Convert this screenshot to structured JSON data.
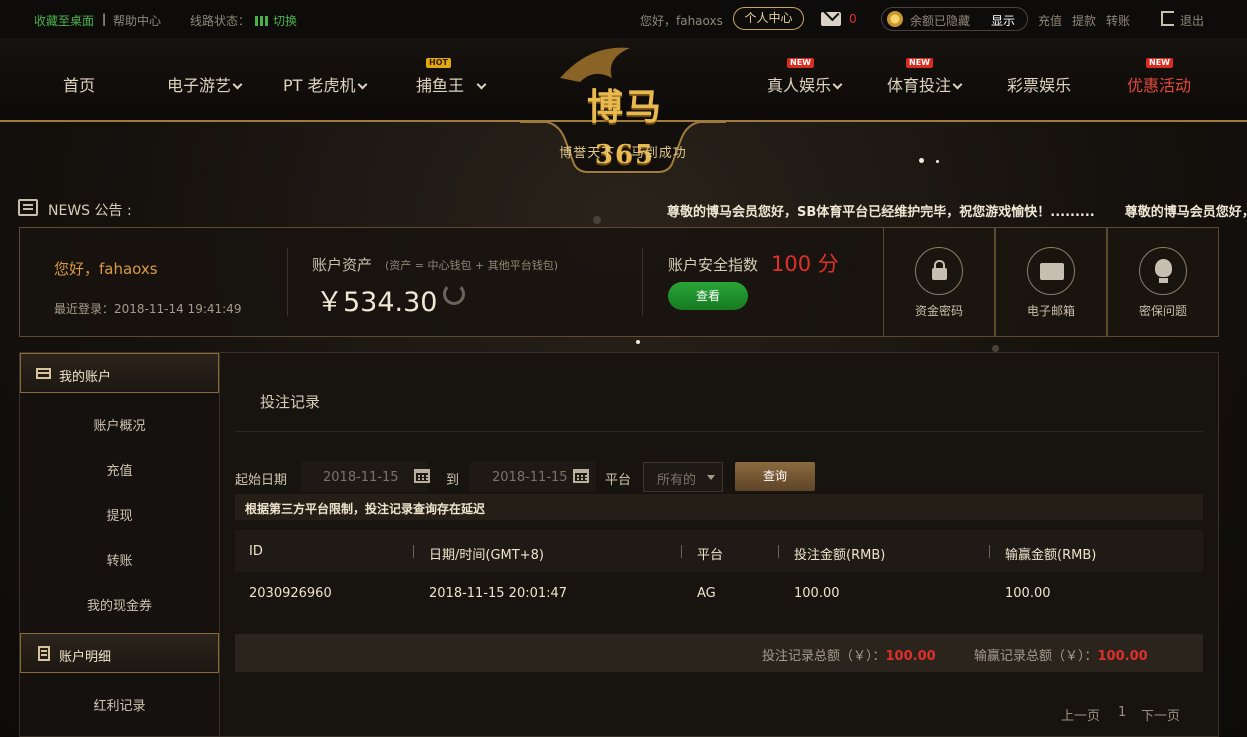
{
  "topbar": {
    "bookmark": "收藏至桌面",
    "separator": "|",
    "help": "帮助中心",
    "line_status_label": "线路状态：",
    "switch": "切换",
    "greeting": "您好，fahaoxs",
    "user_center": "个人中心",
    "mail_count": "0",
    "balance_hidden": "余额已隐藏",
    "show": "显示",
    "deposit": "充值",
    "withdraw": "提款",
    "transfer": "转账",
    "logout": "退出"
  },
  "nav": {
    "home": "首页",
    "egames": "电子游艺",
    "pt": "PT 老虎机",
    "fishing": "捕鱼王",
    "live": "真人娱乐",
    "sports": "体育投注",
    "lottery": "彩票娱乐",
    "promo": "优惠活动",
    "badge_new": "NEW",
    "badge_hot": "HOT"
  },
  "logo": {
    "name": "博马",
    "number": "365",
    "slogan": "博誉天下 · 马到成功"
  },
  "news": {
    "label": "NEWS 公告 :",
    "items": [
      "尊敬的博马会员您好，SB体育平台已经维护完毕，祝您游戏愉快！.........",
      "尊敬的博马会员您好，SB体育平台已经维护完毕，祝您游戏愉快！........."
    ]
  },
  "account": {
    "greeting": "您好，fahaoxs",
    "last_login": "最近登录：2018-11-14 19:41:49",
    "assets_label": "账户资产",
    "assets_note": "(资产 = 中心钱包 + 其他平台钱包)",
    "assets_value": "￥534.30",
    "security_label": "账户安全指数",
    "security_score": "100 分",
    "view_button": "查看",
    "fund_password": "资金密码",
    "email": "电子邮箱",
    "security_question": "密保问题"
  },
  "sidebar": {
    "my_account": "我的账户",
    "items": [
      "账户概况",
      "充值",
      "提现",
      "转账",
      "我的现金券"
    ],
    "details": "账户明细",
    "detail_items": [
      "红利记录"
    ]
  },
  "main": {
    "title": "投注记录",
    "start_date_label": "起始日期",
    "start_date": "2018-11-15",
    "to_label": "到",
    "end_date": "2018-11-15",
    "platform_label": "平台",
    "platform_value": "所有的",
    "query": "查询",
    "notice": "根据第三方平台限制，投注记录查询存在延迟",
    "columns": [
      "ID",
      "日期/时间(GMT+8)",
      "平台",
      "投注金额(RMB)",
      "输赢金额(RMB)"
    ],
    "rows": [
      {
        "id": "2030926960",
        "datetime": "2018-11-15 20:01:47",
        "platform": "AG",
        "bet": "100.00",
        "winloss": "100.00"
      }
    ],
    "total_bet_label": "投注记录总额（￥）：",
    "total_bet": "100.00",
    "total_winloss_label": "输赢记录总额（￥）：",
    "total_winloss": "100.00",
    "prev": "上一页",
    "page": "1",
    "next": "下一页"
  },
  "colors": {
    "gold": "#c8a45d",
    "green": "#4bb14b",
    "red": "#e0302a",
    "background": "#15110d"
  }
}
